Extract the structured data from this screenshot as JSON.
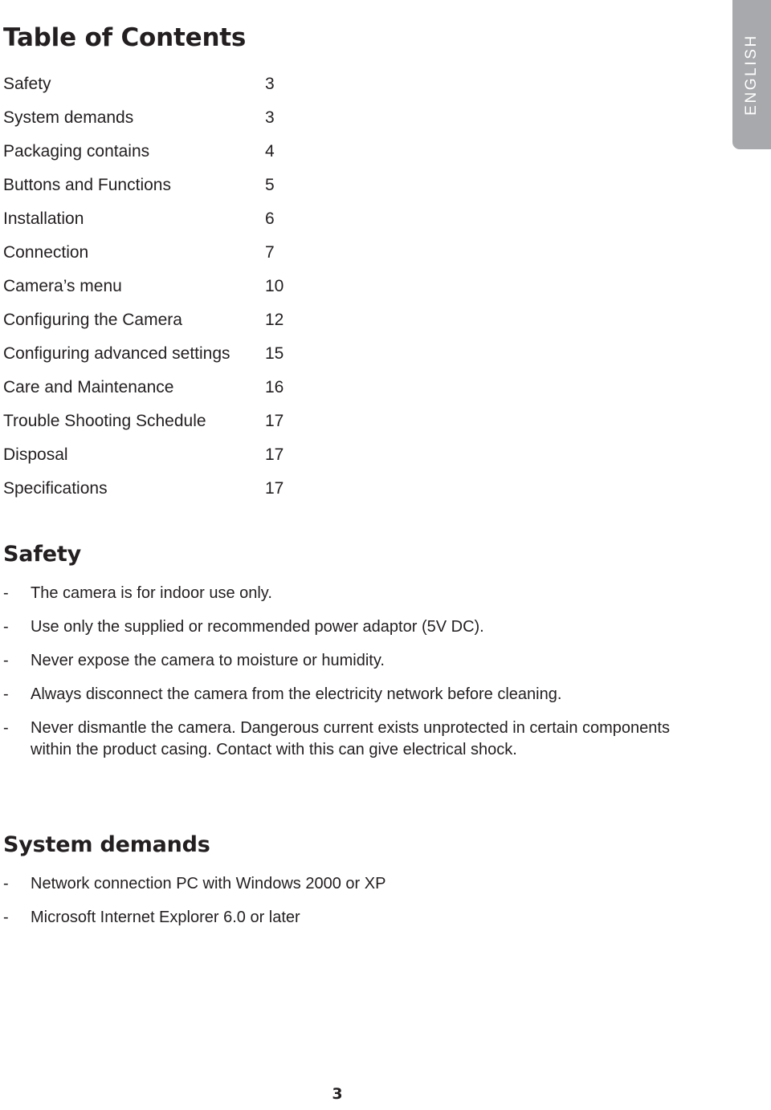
{
  "document": {
    "title": "Table of Contents",
    "language_tab": "ENGLISH",
    "page_number": "3",
    "accent_gray": "#a8a9ad",
    "text_color": "#231f20"
  },
  "toc": {
    "entries": [
      {
        "label": "Safety",
        "page": "3"
      },
      {
        "label": "System demands",
        "page": "3"
      },
      {
        "label": "Packaging contains",
        "page": "4"
      },
      {
        "label": "Buttons and Functions",
        "page": "5"
      },
      {
        "label": "Installation",
        "page": "6"
      },
      {
        "label": "Connection",
        "page": "7"
      },
      {
        "label": "Camera’s menu",
        "page": "10"
      },
      {
        "label": "Configuring the Camera",
        "page": "12"
      },
      {
        "label": "Configuring advanced settings",
        "page": "15"
      },
      {
        "label": "Care and Maintenance",
        "page": "16"
      },
      {
        "label": "Trouble Shooting Schedule",
        "page": "17"
      },
      {
        "label": "Disposal",
        "page": "17"
      },
      {
        "label": "Specifications",
        "page": "17"
      }
    ]
  },
  "sections": [
    {
      "id": "safety",
      "heading": "Safety",
      "bullet_marker": "-",
      "items": [
        "The camera is for indoor use only.",
        "Use only the supplied or recommended power adaptor (5V DC).",
        "Never expose the camera to moisture or humidity.",
        "Always disconnect the camera from the electricity network before cleaning.",
        "Never dismantle the camera. Dangerous current exists unprotected in certain components within the product casing. Contact with this can give electrical shock."
      ]
    },
    {
      "id": "system-demands",
      "heading": "System demands",
      "bullet_marker": "-",
      "items": [
        "Network connection PC with Windows 2000 or XP",
        "Microsoft Internet Explorer 6.0 or later"
      ]
    }
  ]
}
